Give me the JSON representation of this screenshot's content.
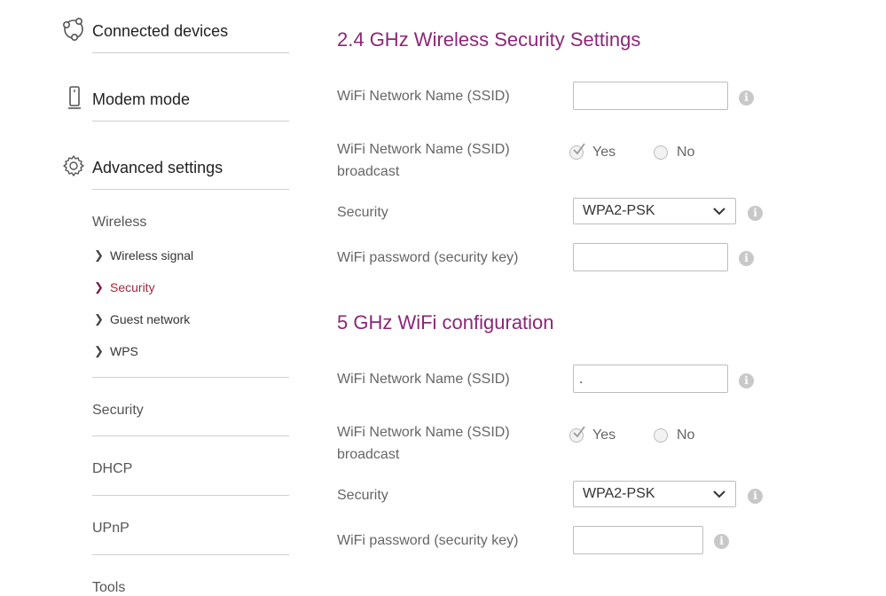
{
  "sidebar": {
    "main_items": [
      {
        "label": "Connected devices",
        "icon": "devices-icon"
      },
      {
        "label": "Modem mode",
        "icon": "modem-icon"
      },
      {
        "label": "Advanced settings",
        "icon": "gear-icon"
      }
    ],
    "submenu_heading": "Wireless",
    "submenu": [
      {
        "label": "Wireless signal",
        "active": false
      },
      {
        "label": "Security",
        "active": true
      },
      {
        "label": "Guest network",
        "active": false
      },
      {
        "label": "WPS",
        "active": false
      }
    ],
    "sections": [
      "Security",
      "DHCP",
      "UPnP",
      "Tools"
    ]
  },
  "band24": {
    "title": "2.4 GHz Wireless Security Settings",
    "ssid_label": "WiFi Network Name (SSID)",
    "ssid_value": "",
    "broadcast_label_line1": "WiFi Network Name (SSID)",
    "broadcast_label_line2": "broadcast",
    "yes_label": "Yes",
    "no_label": "No",
    "broadcast_selected": "Yes",
    "security_label": "Security",
    "security_value": "WPA2-PSK",
    "password_label": "WiFi password (security key)",
    "password_value": ""
  },
  "band5": {
    "title": "5 GHz WiFi configuration",
    "ssid_label": "WiFi Network Name (SSID)",
    "ssid_value": ".",
    "broadcast_label_line1": "WiFi Network Name (SSID)",
    "broadcast_label_line2": "broadcast",
    "yes_label": "Yes",
    "no_label": "No",
    "broadcast_selected": "Yes",
    "security_label": "Security",
    "security_value": "WPA2-PSK",
    "password_label": "WiFi password (security key)",
    "password_value": ""
  },
  "colors": {
    "heading": "#8a2877",
    "active_nav": "#a0283c",
    "info_icon": "#c8c8c8"
  }
}
